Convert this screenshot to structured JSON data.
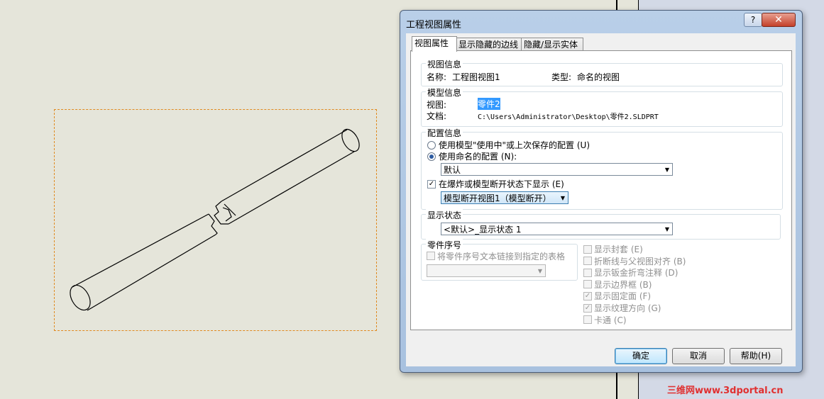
{
  "dialog": {
    "title": "工程视图属性",
    "help_glyph": "?",
    "close_glyph": "✕",
    "tabs": [
      {
        "label": "视图属性"
      },
      {
        "label": "显示隐藏的边线"
      },
      {
        "label": "隐藏/显示实体"
      }
    ],
    "view_info": {
      "group_label": "视图信息",
      "name_label": "名称:",
      "name_value": "工程图视图1",
      "type_label": "类型:",
      "type_value": "命名的视图"
    },
    "model_info": {
      "group_label": "模型信息",
      "view_label": "视图:",
      "view_value": "零件2",
      "doc_label": "文档:",
      "doc_value": "C:\\Users\\Administrator\\Desktop\\零件2.SLDPRT"
    },
    "config_info": {
      "group_label": "配置信息",
      "radio_use_model": "使用模型\"使用中\"或上次保存的配置 (U)",
      "radio_use_named": "使用命名的配置 (N):",
      "named_config_value": "默认",
      "exploded_check": "在爆炸或模型断开状态下显示 (E)",
      "break_view_value": "模型断开视图1（模型断开）"
    },
    "display_state": {
      "group_label": "显示状态",
      "value": "<默认>_显示状态 1"
    },
    "balloon": {
      "group_label": "零件序号",
      "link_check": "将零件序号文本链接到指定的表格"
    },
    "options": [
      {
        "label": "显示封套 (E)",
        "checked": false
      },
      {
        "label": "折断线与父视图对齐 (B)",
        "checked": false
      },
      {
        "label": "显示钣金折弯注释 (D)",
        "checked": false
      },
      {
        "label": "显示边界框 (B)",
        "checked": false
      },
      {
        "label": "显示固定面 (F)",
        "checked": true
      },
      {
        "label": "显示纹理方向 (G)",
        "checked": true
      },
      {
        "label": "卡通 (C)",
        "checked": false
      }
    ],
    "ok_label": "确定",
    "cancel_label": "取消",
    "help_label": "帮助(H)"
  },
  "check_glyph": "✓",
  "dropdown_glyph": "▼",
  "watermark": "三维网www.3dportal.cn",
  "colors": {
    "view_border": "#e08a20",
    "selection": "#3399ff",
    "watermark": "#e03030"
  }
}
